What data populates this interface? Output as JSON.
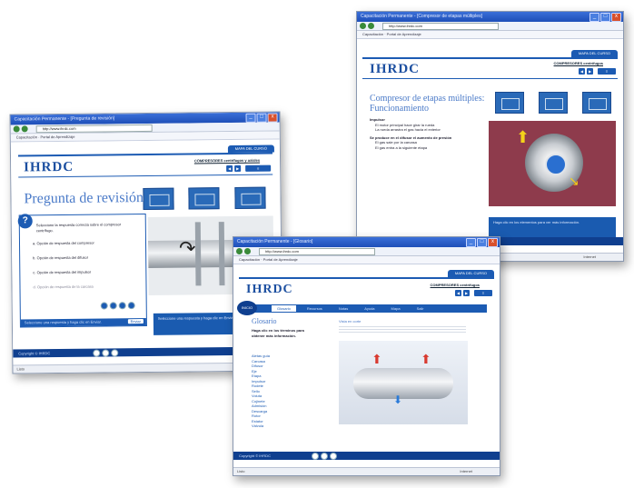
{
  "windows": {
    "left": {
      "title": "Capacitación Permanente - [Pregunta de revisión]",
      "address": "http://www.ihrdc.com",
      "favorites": "Capacitación · Portal de Aprendizaje",
      "banner": "MAPA DEL CURSO",
      "logo": "IHRDC",
      "course_title": "COMPRESORES centrífugos y axiales",
      "heading": "Pregunta de revisión",
      "question_badge": "?",
      "question_text": "Seleccione la respuesta correcta sobre el compresor centrífugo.",
      "options": [
        "a. Opción de respuesta del compresor",
        "b. Opción de respuesta del difusor",
        "c. Opción de respuesta del impulsor",
        "d. Opción de respuesta de la carcasa"
      ],
      "submit_label": "Enviar",
      "info_text": "Seleccione una respuesta y haga clic en Enviar.",
      "bottom_text": "Copyright © IHRDC",
      "status_left": "Listo",
      "status_right": "Internet"
    },
    "top_right": {
      "title": "Capacitación Permanente - [Compresor de etapas múltiples]",
      "address": "http://www.ihrdc.com",
      "favorites": "Capacitación · Portal de Aprendizaje",
      "banner": "MAPA DEL CURSO",
      "logo": "IHRDC",
      "course_title": "COMPRESORES centrífugos",
      "heading_line1": "Compresor de etapas múltiples:",
      "heading_line2": "Funcionamiento",
      "bullets": [
        "Impulsor",
        "El motor principal hace girar la rueda",
        "La rueda arrastra el gas hacia el exterior",
        "Se produce en el difusor el aumento de presión",
        "El gas sale por la carcasa",
        "El gas entra a la siguiente etapa"
      ],
      "info_text": "Haga clic en los elementos para ver más información.",
      "bottom_text": "Copyright © IHRDC",
      "status_left": "Listo",
      "status_right": "Internet"
    },
    "bottom": {
      "title": "Capacitación Permanente - [Glosario]",
      "address": "http://www.ihrdc.com",
      "favorites": "Capacitación · Portal de Aprendizaje",
      "banner": "MAPA DEL CURSO",
      "logo": "IHRDC",
      "course_title": "COMPRESORES centrífugos",
      "badge": "INICIO",
      "tabs": [
        "Glosario",
        "Recursos",
        "Notas",
        "Ayuda",
        "Mapa",
        "Salir"
      ],
      "heading": "Glosario",
      "intro": "Haga clic en los términos para obtener más información.",
      "terms": [
        "Aletas guía",
        "Carcasa",
        "Difusor",
        "Eje",
        "Etapa",
        "Impulsor",
        "Rodete",
        "Sello",
        "Voluta",
        "Cojinete",
        "Admisión",
        "Descarga",
        "Rotor",
        "Estator",
        "Válvula"
      ],
      "caption": "Vista en corte",
      "bottom_text": "Copyright © IHRDC",
      "status_left": "Listo",
      "status_right": "Internet"
    }
  },
  "colors": {
    "brand_blue": "#1c5bb3",
    "dark_blue": "#0f3f8f",
    "accent_red": "#8b3a4a"
  }
}
